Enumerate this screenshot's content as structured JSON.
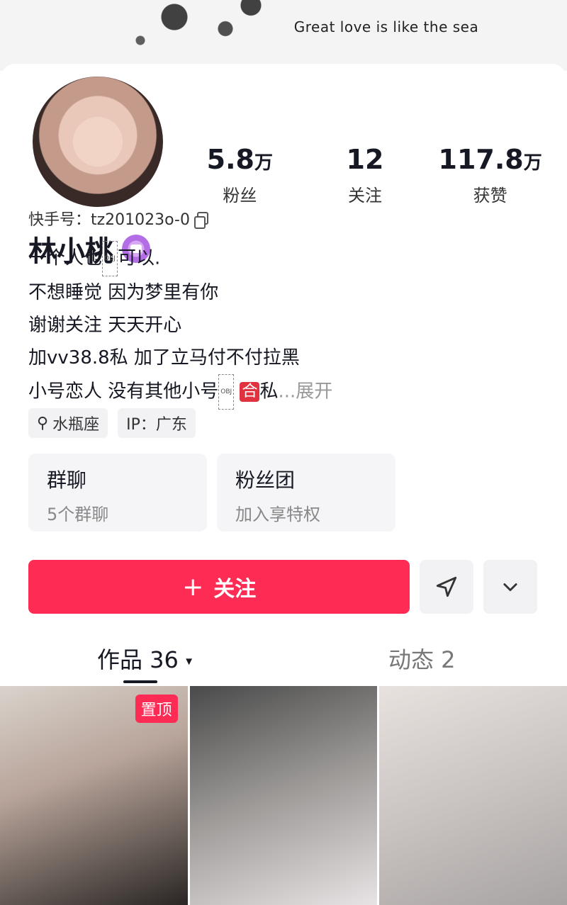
{
  "banner": {
    "text": "Great love is like the sea",
    "subtext": ""
  },
  "profile": {
    "name": "林小桃",
    "uid_label": "快手号：tz201023o-0",
    "bio_lines": [
      "一个人也",
      "可以.",
      "不想睡觉 因为梦里有你",
      "谢谢关注 天天开心",
      "加vv38.8私 加了立马付不付拉黑",
      "小号恋人 没有其他小号",
      "合",
      "私",
      "...展开"
    ],
    "obj_placeholder": "OBJ"
  },
  "stats": [
    {
      "num": "5.8",
      "unit": "万",
      "label": "粉丝"
    },
    {
      "num": "12",
      "unit": "",
      "label": "关注"
    },
    {
      "num": "117.8",
      "unit": "万",
      "label": "获赞"
    }
  ],
  "tags": [
    {
      "icon": "⚲",
      "label": "水瓶座"
    },
    {
      "icon": "",
      "label": "IP：广东"
    }
  ],
  "groups": [
    {
      "title": "群聊",
      "sub": "5个群聊"
    },
    {
      "title": "粉丝团",
      "sub": "加入享特权"
    }
  ],
  "actions": {
    "follow_plus": "+",
    "follow_label": "关注",
    "share_icon": "send-icon",
    "more_icon": "chevron-down-icon"
  },
  "tabs": {
    "works_label": "作品 36",
    "works_caret": "▾",
    "moments_label": "动态 2"
  },
  "grid": {
    "pinned_label": "置顶"
  },
  "colors": {
    "accent": "#fe2c55",
    "text": "#161823"
  }
}
